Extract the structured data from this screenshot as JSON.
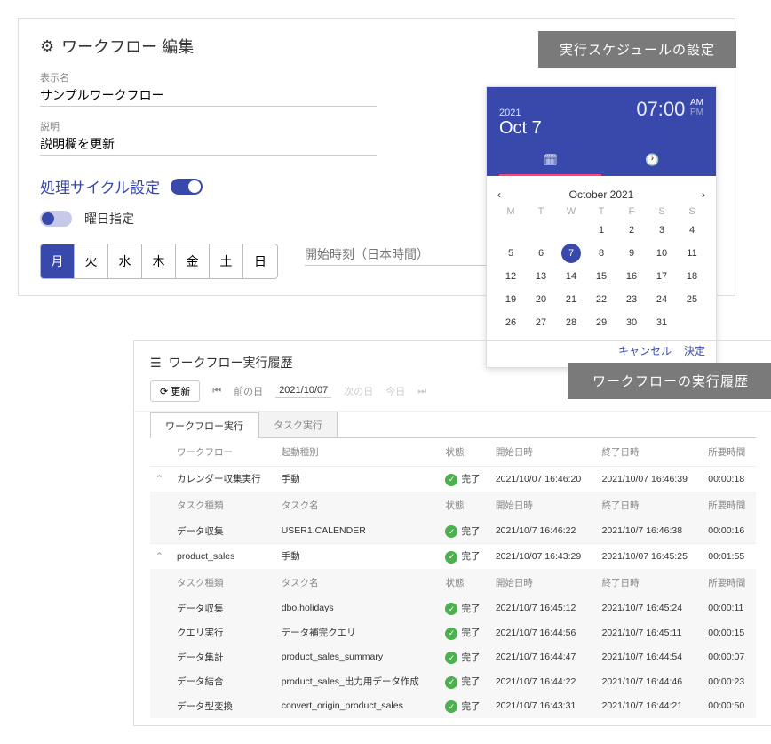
{
  "top": {
    "title": "ワークフロー 編集",
    "display_label": "表示名",
    "display_value": "サンプルワークフロー",
    "desc_label": "説明",
    "desc_value": "説明欄を更新",
    "cycle_title": "処理サイクル設定",
    "dow_label": "曜日指定",
    "days": [
      "月",
      "火",
      "水",
      "木",
      "金",
      "土",
      "日"
    ],
    "selected_day_index": 0,
    "time_placeholder": "開始時刻（日本時間）",
    "banner": "実行スケジュールの設定"
  },
  "dp": {
    "year": "2021",
    "date": "Oct 7",
    "time": "07:00",
    "am": "AM",
    "pm": "PM",
    "month_label": "October 2021",
    "dow": [
      "M",
      "T",
      "W",
      "T",
      "F",
      "S",
      "S"
    ],
    "selected": 7,
    "cancel": "キャンセル",
    "ok": "決定"
  },
  "hist": {
    "title": "ワークフロー実行履歴",
    "banner": "ワークフローの実行履歴",
    "refresh": "更新",
    "prev": "前の日",
    "next": "次の日",
    "today": "今日",
    "date": "2021/10/07",
    "tab1": "ワークフロー実行",
    "tab2": "タスク実行",
    "cols": {
      "wf": "ワークフロー",
      "trig": "起動種別",
      "st": "状態",
      "start": "開始日時",
      "end": "終了日時",
      "dur": "所要時間"
    },
    "subcols": {
      "kind": "タスク種類",
      "name": "タスク名",
      "st": "状態",
      "start": "開始日時",
      "end": "終了日時",
      "dur": "所要時間"
    },
    "status_done": "完了",
    "rows": [
      {
        "wf": "カレンダー収集実行",
        "trig": "手動",
        "start": "2021/10/07 16:46:20",
        "end": "2021/10/07 16:46:39",
        "dur": "00:00:18",
        "tasks": [
          {
            "kind": "データ収集",
            "name": "USER1.CALENDER",
            "start": "2021/10/7 16:46:22",
            "end": "2021/10/7 16:46:38",
            "dur": "00:00:16"
          }
        ]
      },
      {
        "wf": "product_sales",
        "trig": "手動",
        "start": "2021/10/07 16:43:29",
        "end": "2021/10/07 16:45:25",
        "dur": "00:01:55",
        "tasks": [
          {
            "kind": "データ収集",
            "name": "dbo.holidays",
            "start": "2021/10/7 16:45:12",
            "end": "2021/10/7 16:45:24",
            "dur": "00:00:11"
          },
          {
            "kind": "クエリ実行",
            "name": "データ補完クエリ",
            "start": "2021/10/7 16:44:56",
            "end": "2021/10/7 16:45:11",
            "dur": "00:00:15"
          },
          {
            "kind": "データ集計",
            "name": "product_sales_summary",
            "start": "2021/10/7 16:44:47",
            "end": "2021/10/7 16:44:54",
            "dur": "00:00:07"
          },
          {
            "kind": "データ結合",
            "name": "product_sales_出力用データ作成",
            "start": "2021/10/7 16:44:22",
            "end": "2021/10/7 16:44:46",
            "dur": "00:00:23"
          },
          {
            "kind": "データ型変換",
            "name": "convert_origin_product_sales",
            "start": "2021/10/7 16:43:31",
            "end": "2021/10/7 16:44:21",
            "dur": "00:00:50"
          }
        ]
      }
    ]
  }
}
